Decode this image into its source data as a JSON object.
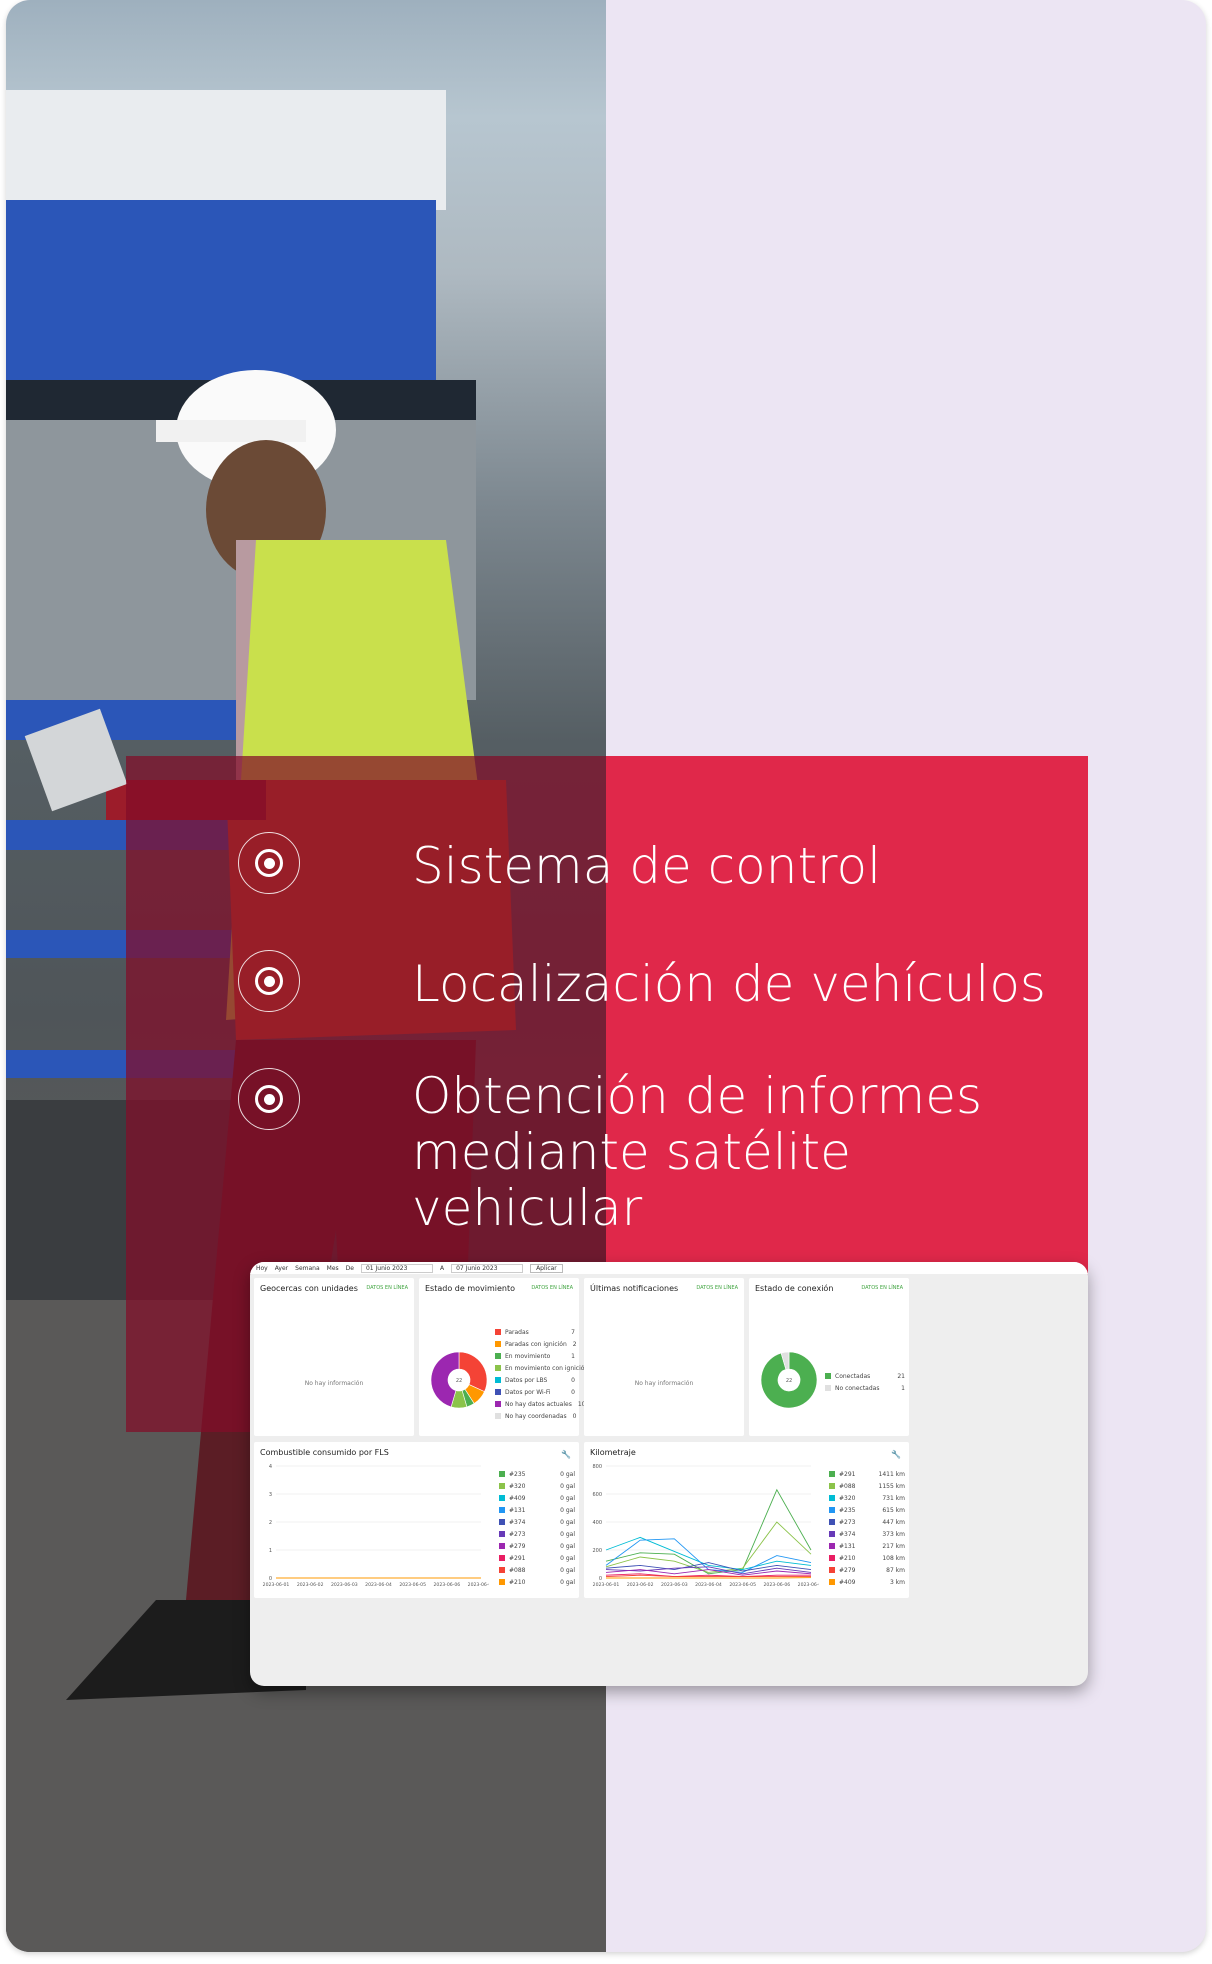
{
  "features": [
    {
      "label": "Sistema de control",
      "icon": "target-icon"
    },
    {
      "label": "Localización de vehículos",
      "icon": "target-icon"
    },
    {
      "label_lines": [
        "Obtención de informes",
        "mediante satélite",
        "vehicular"
      ],
      "icon": "target-icon"
    }
  ],
  "colors": {
    "accent_red": "#e0284a",
    "background": "#ece5f3",
    "live_green": "#41a541"
  },
  "dashboard": {
    "toolbar": {
      "items": [
        "Hoy",
        "Ayer",
        "Semana",
        "Mes"
      ],
      "from_label": "De",
      "from_value": "01 Junio 2023",
      "to_label": "A",
      "to_value": "07 Junio 2023",
      "apply": "Aplicar"
    },
    "live_label": "DATOS EN LÍNEA",
    "no_info": "No hay información",
    "geofences": {
      "title": "Geocercas con unidades"
    },
    "movement": {
      "title": "Estado de movimiento",
      "total": "22",
      "legend": [
        {
          "label": "Paradas",
          "value": "7",
          "color": "#f44336"
        },
        {
          "label": "Paradas con ignición",
          "value": "2",
          "color": "#ff9800"
        },
        {
          "label": "En movimiento",
          "value": "1",
          "color": "#4caf50"
        },
        {
          "label": "En movimiento con ignición",
          "value": "2",
          "color": "#8bc34a"
        },
        {
          "label": "Datos por LBS",
          "value": "0",
          "color": "#00bcd4"
        },
        {
          "label": "Datos por Wi-Fi",
          "value": "0",
          "color": "#3f51b5"
        },
        {
          "label": "No hay datos actuales",
          "value": "10",
          "color": "#9c27b0"
        },
        {
          "label": "No hay coordenadas",
          "value": "0",
          "color": "#e0e0e0"
        }
      ]
    },
    "notifications": {
      "title": "Últimas notificaciones"
    },
    "connection": {
      "title": "Estado de conexión",
      "total": "22",
      "legend": [
        {
          "label": "Conectadas",
          "value": "21",
          "color": "#4caf50"
        },
        {
          "label": "No conectadas",
          "value": "1",
          "color": "#e0e0e0"
        }
      ]
    },
    "fuel": {
      "title": "Combustible consumido por FLS",
      "legend": [
        {
          "label": "#235",
          "value": "0 gal",
          "color": "#4caf50"
        },
        {
          "label": "#320",
          "value": "0 gal",
          "color": "#8bc34a"
        },
        {
          "label": "#409",
          "value": "0 gal",
          "color": "#00bcd4"
        },
        {
          "label": "#131",
          "value": "0 gal",
          "color": "#2196f3"
        },
        {
          "label": "#374",
          "value": "0 gal",
          "color": "#3f51b5"
        },
        {
          "label": "#273",
          "value": "0 gal",
          "color": "#673ab7"
        },
        {
          "label": "#279",
          "value": "0 gal",
          "color": "#9c27b0"
        },
        {
          "label": "#291",
          "value": "0 gal",
          "color": "#e91e63"
        },
        {
          "label": "#088",
          "value": "0 gal",
          "color": "#f44336"
        },
        {
          "label": "#210",
          "value": "0 gal",
          "color": "#ff9800"
        }
      ]
    },
    "mileage": {
      "title": "Kilometraje",
      "legend": [
        {
          "label": "#291",
          "value": "1411 km",
          "color": "#4caf50"
        },
        {
          "label": "#088",
          "value": "1155 km",
          "color": "#8bc34a"
        },
        {
          "label": "#320",
          "value": "731 km",
          "color": "#00bcd4"
        },
        {
          "label": "#235",
          "value": "615 km",
          "color": "#2196f3"
        },
        {
          "label": "#273",
          "value": "447 km",
          "color": "#3f51b5"
        },
        {
          "label": "#374",
          "value": "373 km",
          "color": "#673ab7"
        },
        {
          "label": "#131",
          "value": "217 km",
          "color": "#9c27b0"
        },
        {
          "label": "#210",
          "value": "108 km",
          "color": "#e91e63"
        },
        {
          "label": "#279",
          "value": "87 km",
          "color": "#f44336"
        },
        {
          "label": "#409",
          "value": "3 km",
          "color": "#ff9800"
        }
      ]
    }
  },
  "chart_data": [
    {
      "type": "line",
      "title": "Combustible consumido por FLS",
      "x": [
        "2023-06-01",
        "2023-06-02",
        "2023-06-03",
        "2023-06-04",
        "2023-06-05",
        "2023-06-06",
        "2023-06-07"
      ],
      "yticks": [
        "0",
        "1",
        "2",
        "3",
        "4"
      ],
      "ylim": [
        0,
        4
      ],
      "series": [
        {
          "name": "#210",
          "values": [
            0,
            0,
            0,
            0,
            0,
            0,
            0
          ]
        }
      ]
    },
    {
      "type": "line",
      "title": "Kilometraje",
      "x": [
        "2023-06-01",
        "2023-06-02",
        "2023-06-03",
        "2023-06-04",
        "2023-06-05",
        "2023-06-06",
        "2023-06-07"
      ],
      "yticks": [
        "0",
        "200",
        "400",
        "600",
        "800"
      ],
      "ylim": [
        0,
        800
      ],
      "series": [
        {
          "name": "#291",
          "values": [
            120,
            180,
            170,
            30,
            60,
            630,
            200
          ]
        },
        {
          "name": "#088",
          "values": [
            80,
            150,
            120,
            40,
            70,
            400,
            170
          ]
        },
        {
          "name": "#320",
          "values": [
            200,
            290,
            190,
            90,
            60,
            120,
            90
          ]
        },
        {
          "name": "#235",
          "values": [
            90,
            270,
            280,
            60,
            40,
            160,
            110
          ]
        },
        {
          "name": "#273",
          "values": [
            70,
            90,
            60,
            110,
            50,
            90,
            60
          ]
        },
        {
          "name": "#374",
          "values": [
            60,
            50,
            70,
            80,
            30,
            70,
            40
          ]
        },
        {
          "name": "#131",
          "values": [
            40,
            60,
            30,
            60,
            20,
            50,
            30
          ]
        },
        {
          "name": "#210",
          "values": [
            20,
            30,
            10,
            20,
            10,
            20,
            20
          ]
        },
        {
          "name": "#279",
          "values": [
            10,
            20,
            10,
            10,
            10,
            10,
            10
          ]
        },
        {
          "name": "#409",
          "values": [
            0,
            0,
            0,
            0,
            0,
            0,
            3
          ]
        }
      ]
    }
  ]
}
